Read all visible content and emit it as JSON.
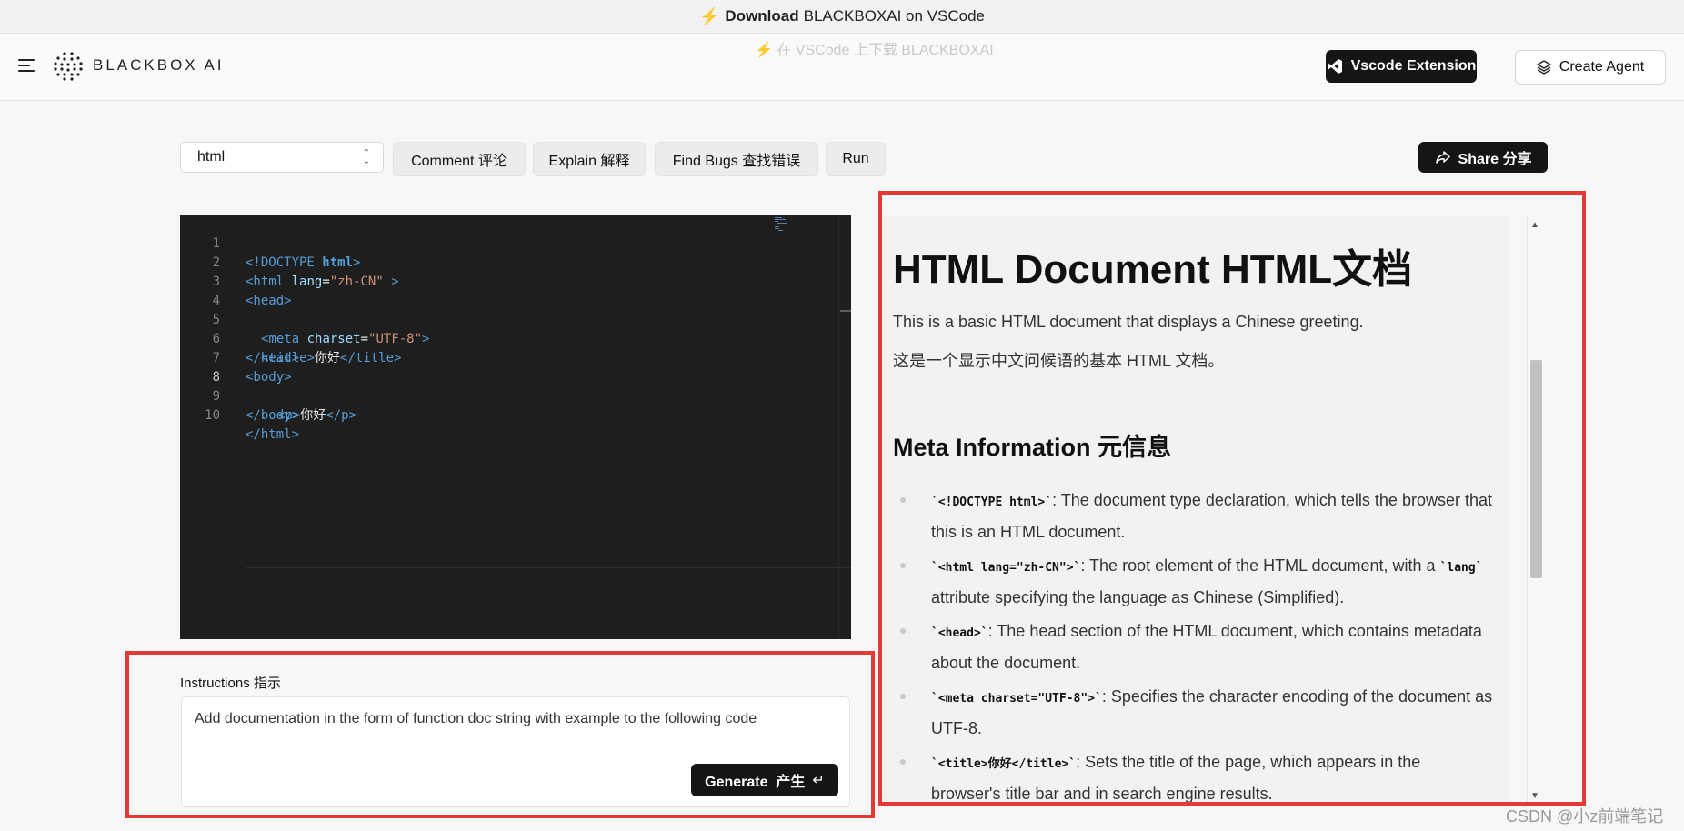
{
  "banner": {
    "prefix": "Download",
    "text": "BLACKBOXAI on VSCode",
    "ghost": "⚡ 在 VSCode 上下载 BLACKBOXAI"
  },
  "header": {
    "brand": "BLACKBOX AI",
    "vscode_label": "Vscode Extension",
    "agent_label": "Create Agent"
  },
  "toolbar": {
    "language": "html",
    "comment_label": "Comment 评论",
    "explain_label": "Explain 解释",
    "findbugs_label": "Find Bugs 查找错误",
    "run_label": "Run",
    "share_label": "Share 分享"
  },
  "editor": {
    "line_numbers": [
      "1",
      "2",
      "3",
      "4",
      "5",
      "6",
      "7",
      "8",
      "9",
      "10"
    ],
    "current_line": "8",
    "code": {
      "l1_open": "<!DOCTYPE",
      "l1_name": " html",
      "l1_close": ">",
      "l2_open": "<html",
      "l2_attr": " lang",
      "l2_eq": "=",
      "l2_val": "\"zh-CN\"",
      "l2_close": " >",
      "l3": "<head>",
      "l4_open": "<meta",
      "l4_attr": " charset",
      "l4_eq": "=",
      "l4_val": "\"UTF-8\"",
      "l4_close": ">",
      "l5_open": "<title>",
      "l5_text": "你好",
      "l5_close": "</title>",
      "l6": "</head>",
      "l7": "<body>",
      "l8_open": "<p>",
      "l8_text": "你好",
      "l8_close": "</p>",
      "l9": "</body>",
      "l10": "</html>"
    }
  },
  "instructions": {
    "label": "Instructions 指示",
    "text": "Add documentation in the form of function doc string with example to the following code",
    "generate_label": "Generate  产生",
    "return_glyph": "↵"
  },
  "output": {
    "title": "HTML Document HTML文档",
    "intro_en": "This is a basic HTML document that displays a Chinese greeting.",
    "intro_zh": "这是一个显示中文问候语的基本 HTML 文档。",
    "meta_heading": "Meta Information 元信息",
    "items": [
      {
        "code": "`<!DOCTYPE html>`",
        "text": ": The document type declaration, which tells the browser that this is an HTML document."
      },
      {
        "code": "`<html lang=\"zh-CN\">`",
        "text": ": The root element of the HTML document, with a ",
        "code2": "`lang`",
        "text2": " attribute specifying the language as Chinese (Simplified)."
      },
      {
        "code": "`<head>`",
        "text": ": The head section of the HTML document, which contains metadata about the document."
      },
      {
        "code": "`<meta charset=\"UTF-8\">`",
        "text": ": Specifies the character encoding of the document as UTF-8."
      },
      {
        "code": "`<title>你好</title>`",
        "text": ": Sets the title of the page, which appears in the browser's title bar and in search engine results."
      }
    ]
  },
  "watermark": "CSDN @小z前端笔记",
  "colors": {
    "highlight_box": "#e53935",
    "editor_bg": "#1e1e1e",
    "button_dark": "#151515"
  }
}
